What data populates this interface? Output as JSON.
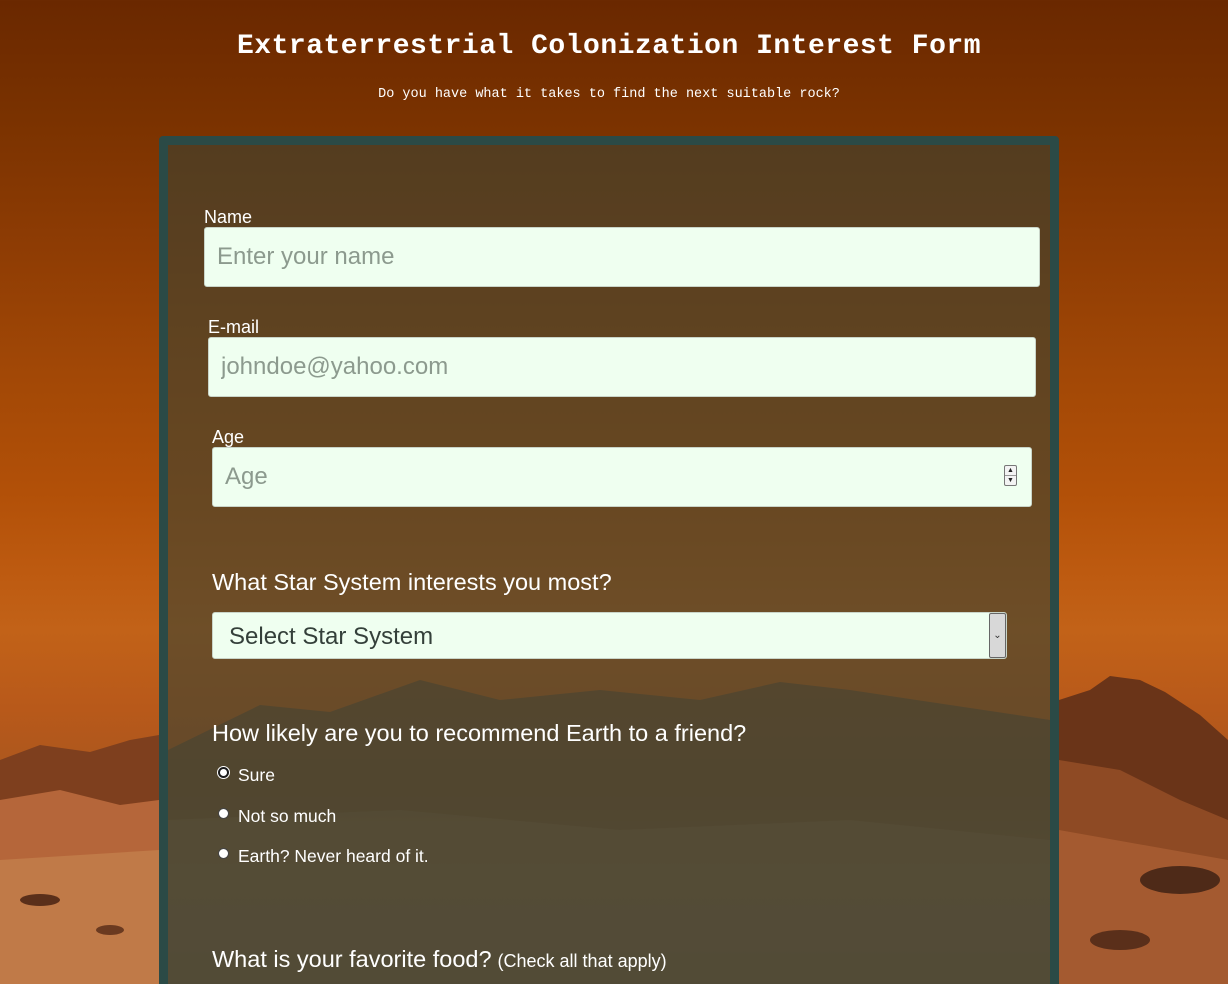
{
  "header": {
    "title": "Extraterrestrial Colonization Interest Form",
    "subtitle": "Do you have what it takes to find the next suitable rock?"
  },
  "form": {
    "name": {
      "label": "Name",
      "placeholder": "Enter your name",
      "value": ""
    },
    "email": {
      "label": "E-mail",
      "placeholder": "johndoe@yahoo.com",
      "value": ""
    },
    "age": {
      "label": "Age",
      "placeholder": "Age",
      "value": ""
    },
    "star_system": {
      "question": "What Star System interests you most?",
      "selected": "Select Star System"
    },
    "recommend": {
      "question": "How likely are you to recommend Earth to a friend?",
      "options": [
        "Sure",
        "Not so much",
        "Earth? Never heard of it."
      ],
      "focused_option": "Sure"
    },
    "food": {
      "question": "What is your favorite food?",
      "hint": "(Check all that apply)"
    }
  },
  "icons": {
    "spinner": "number-spinner-icon",
    "select_arrow": "chevron-down-icon"
  },
  "colors": {
    "panel_border": "#2b4a46",
    "input_background": "#effff0",
    "sky_top": "#6a2800",
    "sky_bottom": "#c26218"
  }
}
